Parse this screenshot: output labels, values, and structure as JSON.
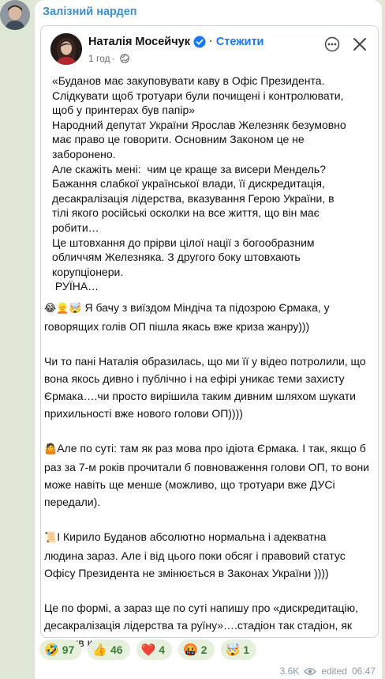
{
  "channel": {
    "name": "Залізний нардеп"
  },
  "post": {
    "author": "Наталія Мосейчук",
    "follow_label": "Стежити",
    "time": "1 год",
    "paragraphs": [
      "«Буданов має закуповувати каву в Офіс Президента.\nСлідкувати щоб тротуари були почищені і контролювати,\nщоб у принтерах був папір»\nНародний депутат України Ярослав Железняк безумовно\nмає право це говорити. Основним Законом це не\nзаборонено.\nАле скажіть мені:  чим це краще за висери Мендель?\nБажання слабкої української влади, її дискредитація,\nдесакралізація лідерства, вказування Герою України, в\nтілі якого російські осколки на все життя, що він має\nробити…\nЦе штовхання до прірви цілої нації з богообразним\nобличчям Железняка. З другого боку штовхають\nкорупціонери.\n РУЇНА…"
    ]
  },
  "comment": {
    "paragraphs": [
      {
        "emoji": "😂👱🤯",
        "text": " Я бачу з виїздом Міндіча та підозрою Єрмака, у\nговорящих голів ОП пішла якась вже криза жанру)))"
      },
      {
        "emoji": "",
        "text": "Чи то пані Наталія образилась, що ми її у відео потролили, що\nвона якось дивно і публічно і на ефірі уникає теми захисту\nЄрмака….чи просто вирішила таким дивним шляхом шукати\nприхильності вже нового голови ОП))))"
      },
      {
        "emoji": "🤷",
        "text": "Але по суті: там як раз мова про ідіота Єрмака. І так, якщо б\nраз за 7-м років прочитали б повноваження голови ОП, то вони\nможе навіть ще менше (можливо, що тротуари вже ДУСі\nпередали)."
      },
      {
        "emoji": "📜",
        "text": "І Кирило Буданов абсолютно нормальна і адекватна\nлюдина зараз. Але і від цього поки обсяг і правовий статус\nОфісу Президента не змінюється в Законах України ))))"
      },
      {
        "emoji": "",
        "text": "Це по формі, а зараз ще по суті напишу про «дискредитацію,\nдесакралізація лідерства та руїну»….стадіон так стадіон, як\nговорив класик"
      }
    ]
  },
  "reactions": [
    {
      "emoji": "🤣",
      "count": "97"
    },
    {
      "emoji": "👍",
      "count": "46"
    },
    {
      "emoji": "❤️",
      "count": "4"
    },
    {
      "emoji": "🤬",
      "count": "2"
    },
    {
      "emoji": "🤯",
      "count": "1"
    }
  ],
  "footer": {
    "views": "3.6K",
    "edited_label": "edited",
    "time": "06:47"
  },
  "icons": {
    "verified": "verified-badge-icon",
    "globe": "globe-icon",
    "more": "more-icon",
    "close": "close-icon",
    "eye": "eye-icon"
  },
  "colors": {
    "channel_name": "#3a8fd6",
    "follow": "#1877f2",
    "reaction_bg": "#e6f0dc",
    "background": "#dfe8d6"
  }
}
